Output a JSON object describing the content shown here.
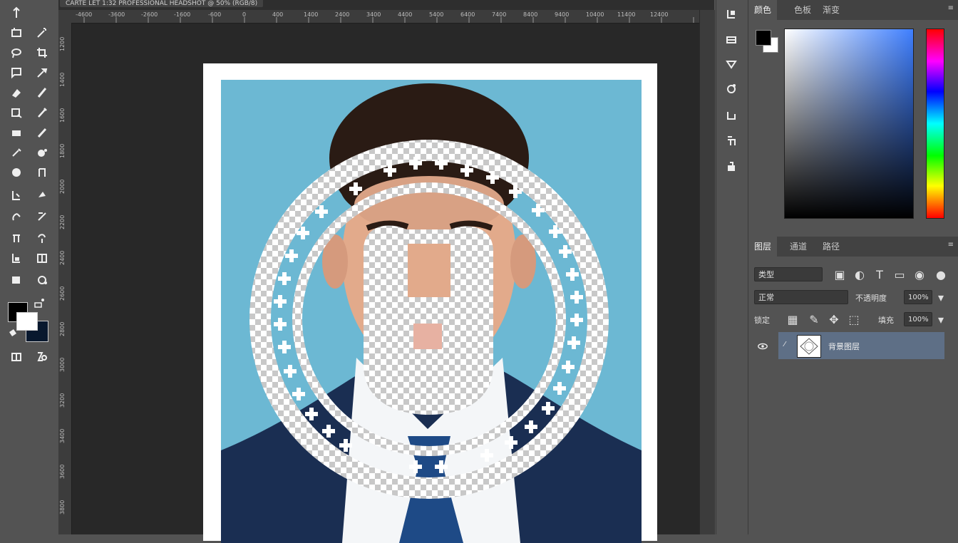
{
  "document": {
    "tab_title": "CARTE LET 1:32 PROFESSIONAL HEADSHOT @ 50% (RGB/8)"
  },
  "rulers": {
    "top": [
      "-4600",
      "-3600",
      "-2600",
      "-1600",
      "-600",
      "0",
      "400",
      "1400",
      "2400",
      "3400",
      "4400",
      "5400",
      "6400",
      "7400",
      "8400",
      "9400",
      "10400",
      "11400",
      "12400"
    ],
    "left": [
      "1200",
      "1400",
      "1600",
      "1800",
      "2000",
      "2200",
      "2400",
      "2600",
      "2800",
      "3000",
      "3200",
      "3400",
      "3600",
      "3800",
      "4000"
    ]
  },
  "color_panel": {
    "tabs": [
      "颜色",
      "色板",
      "渐变"
    ],
    "foreground": "#000000",
    "background": "#ffffff"
  },
  "layers_panel": {
    "tabs": [
      "图层",
      "通道",
      "路径"
    ],
    "filter_label": "类型",
    "blend_mode": "正常",
    "opacity_label": "不透明度",
    "opacity_value": "100%",
    "lock_label": "锁定",
    "fill_label": "填充",
    "fill_value": "100%",
    "layers": [
      {
        "name": "背景图层",
        "visible": true,
        "selected": true
      }
    ]
  },
  "colors": {
    "photo_bg": "#6cb8d3",
    "suit": "#1a2e52",
    "tie": "#1e4a86",
    "selection": "#5e6f86"
  }
}
